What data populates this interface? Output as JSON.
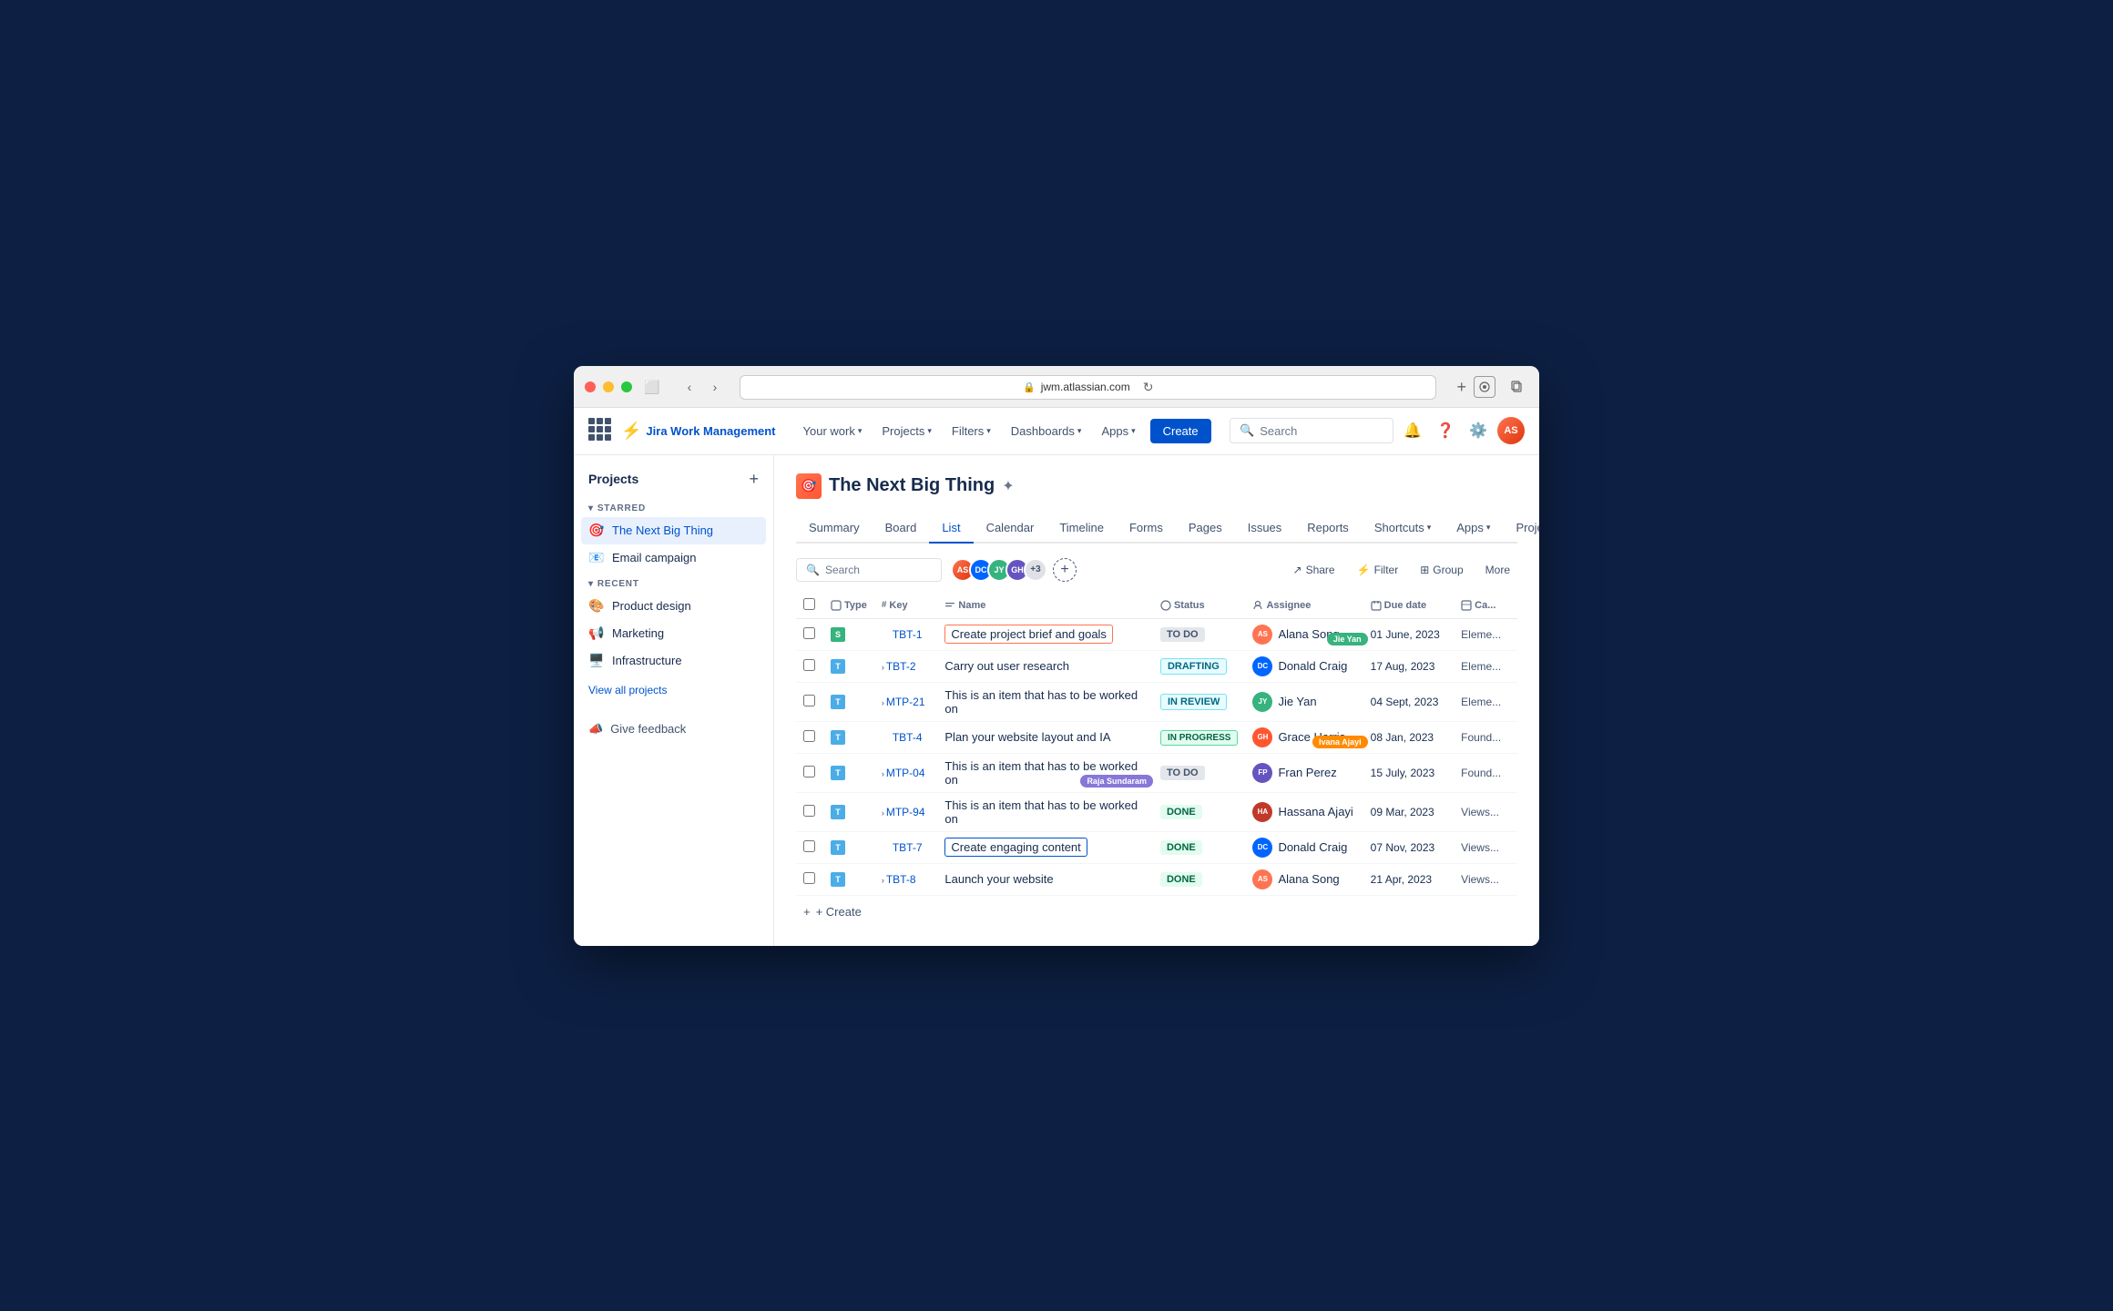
{
  "browser": {
    "url": "jwm.atlassian.com",
    "lock_icon": "🔒",
    "refresh_icon": "↻",
    "back_icon": "‹",
    "forward_icon": "›"
  },
  "topnav": {
    "logo_text": "Jira Work Management",
    "your_work": "Your work",
    "projects": "Projects",
    "filters": "Filters",
    "dashboards": "Dashboards",
    "apps": "Apps",
    "create": "Create",
    "search_placeholder": "Search"
  },
  "sidebar": {
    "title": "Projects",
    "add_label": "+",
    "starred_label": "STARRED",
    "recent_label": "RECENT",
    "starred_items": [
      {
        "name": "The Next Big Thing",
        "icon": "🎯",
        "active": true
      },
      {
        "name": "Email campaign",
        "icon": "📧",
        "active": false
      }
    ],
    "recent_items": [
      {
        "name": "Product design",
        "icon": "🎨"
      },
      {
        "name": "Marketing",
        "icon": "📢"
      },
      {
        "name": "Infrastructure",
        "icon": "🖥️"
      }
    ],
    "view_all": "View all projects",
    "give_feedback": "Give feedback"
  },
  "project": {
    "title": "The Next Big Thing",
    "icon": "🎯",
    "tabs": [
      {
        "label": "Summary",
        "active": false
      },
      {
        "label": "Board",
        "active": false
      },
      {
        "label": "List",
        "active": true
      },
      {
        "label": "Calendar",
        "active": false
      },
      {
        "label": "Timeline",
        "active": false
      },
      {
        "label": "Forms",
        "active": false
      },
      {
        "label": "Pages",
        "active": false
      },
      {
        "label": "Issues",
        "active": false
      },
      {
        "label": "Reports",
        "active": false
      },
      {
        "label": "Shortcuts",
        "active": false,
        "hasArrow": true
      },
      {
        "label": "Apps",
        "active": false,
        "hasArrow": true
      },
      {
        "label": "Project settings",
        "active": false
      }
    ]
  },
  "list_controls": {
    "search_placeholder": "Search",
    "avatars_count": "+3",
    "share": "Share",
    "filter": "Filter",
    "group": "Group",
    "more": "More"
  },
  "table": {
    "headers": [
      "Type",
      "Key",
      "Name",
      "Status",
      "Assignee",
      "Due date",
      "Ca..."
    ],
    "rows": [
      {
        "type": "story",
        "key": "TBT-1",
        "name": "Create project brief and goals",
        "highlight": "orange",
        "status": "TO DO",
        "status_class": "status-todo",
        "assignee": "Alana Song",
        "assignee_color": "#ff7452",
        "assignee_initials": "AS",
        "due_date": "01 June, 2023",
        "category": "Eleme...",
        "tooltip": null,
        "tooltip_color": null,
        "checked": false,
        "expandable": false
      },
      {
        "type": "task",
        "key": "TBT-2",
        "name": "Carry out user research",
        "highlight": null,
        "status": "DRAFTING",
        "status_class": "status-drafting",
        "assignee": "Donald Craig",
        "assignee_color": "#0065ff",
        "assignee_initials": "DC",
        "due_date": "17 Aug, 2023",
        "category": "Eleme...",
        "tooltip": "Jie Yan",
        "tooltip_color": "green",
        "checked": true,
        "expandable": true
      },
      {
        "type": "task",
        "key": "MTP-21",
        "name": "This is an item that has to be worked on",
        "highlight": null,
        "status": "IN REVIEW",
        "status_class": "status-inreview",
        "assignee": "Jie Yan",
        "assignee_color": "#36b37e",
        "assignee_initials": "JY",
        "due_date": "04 Sept, 2023",
        "category": "Eleme...",
        "tooltip": null,
        "tooltip_color": null,
        "checked": true,
        "expandable": true
      },
      {
        "type": "task",
        "key": "TBT-4",
        "name": "Plan your website layout and IA",
        "highlight": null,
        "status": "IN PROGRESS",
        "status_class": "status-inprogress",
        "assignee": "Grace Harris",
        "assignee_color": "#ff5630",
        "assignee_initials": "GH",
        "due_date": "08 Jan, 2023",
        "category": "Found...",
        "tooltip": null,
        "tooltip_color": null,
        "checked": true,
        "expandable": false
      },
      {
        "type": "task",
        "key": "MTP-04",
        "name": "This is an item that has to be worked on",
        "highlight": null,
        "status": "TO DO",
        "status_class": "status-todo",
        "assignee": "Fran Perez",
        "assignee_color": "#6554c0",
        "assignee_initials": "FP",
        "due_date": "15 July, 2023",
        "category": "Found...",
        "tooltip": "Ivana Ajayi",
        "tooltip_color": "orange",
        "checked": true,
        "expandable": true
      },
      {
        "type": "task",
        "key": "MTP-94",
        "name": "This is an item that has to be worked on",
        "highlight": null,
        "status": "DONE",
        "status_class": "status-done",
        "assignee": "Hassana Ajayi",
        "assignee_color": "#c0392b",
        "assignee_initials": "HA",
        "due_date": "09 Mar, 2023",
        "category": "Views...",
        "tooltip": "Raja Sundaram",
        "tooltip_color": "purple",
        "tooltip_on_name": true,
        "checked": true,
        "expandable": true
      },
      {
        "type": "task",
        "key": "TBT-7",
        "name": "Create engaging content",
        "highlight": "blue",
        "status": "DONE",
        "status_class": "status-done",
        "assignee": "Donald Craig",
        "assignee_color": "#0065ff",
        "assignee_initials": "DC",
        "due_date": "07 Nov, 2023",
        "category": "Views...",
        "tooltip": null,
        "tooltip_color": null,
        "checked": true,
        "expandable": false
      },
      {
        "type": "task",
        "key": "TBT-8",
        "name": "Launch your website",
        "highlight": null,
        "status": "DONE",
        "status_class": "status-done",
        "assignee": "Alana Song",
        "assignee_color": "#ff7452",
        "assignee_initials": "AS",
        "due_date": "21 Apr, 2023",
        "category": "Views...",
        "tooltip": null,
        "tooltip_color": null,
        "checked": true,
        "expandable": true
      }
    ],
    "create_label": "+ Create"
  }
}
